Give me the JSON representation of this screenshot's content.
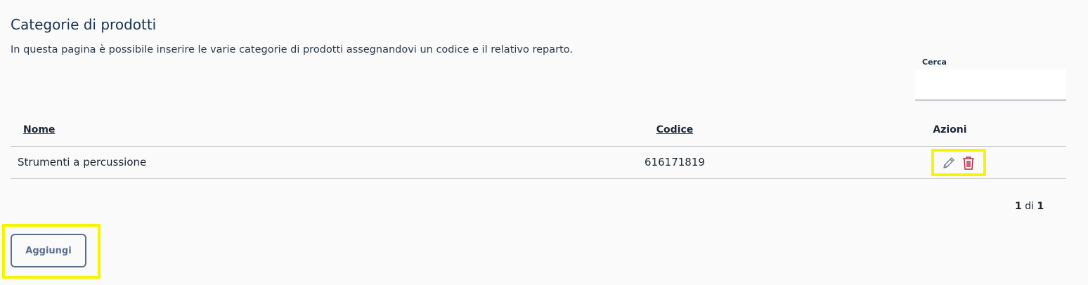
{
  "page": {
    "title": "Categorie di prodotti",
    "description": "In questa pagina è possibile inserire le varie categorie di prodotti assegnandovi un codice e il relativo reparto."
  },
  "search": {
    "label": "Cerca",
    "value": "",
    "placeholder": ""
  },
  "table": {
    "headers": {
      "nome": "Nome",
      "codice": "Codice",
      "azioni": "Azioni"
    },
    "rows": [
      {
        "nome": "Strumenti a percussione",
        "codice": "616171819",
        "actions": [
          "pencil-icon",
          "trash-icon"
        ]
      }
    ]
  },
  "pagination": {
    "current": "1",
    "separator": "di",
    "total": "1"
  },
  "add_button": {
    "label": "Aggiungi"
  },
  "colors": {
    "edit_icon": "#6e7f95",
    "delete_icon": "#b3263f",
    "highlight": "#f5f500",
    "button_border": "#5b6f8c"
  }
}
